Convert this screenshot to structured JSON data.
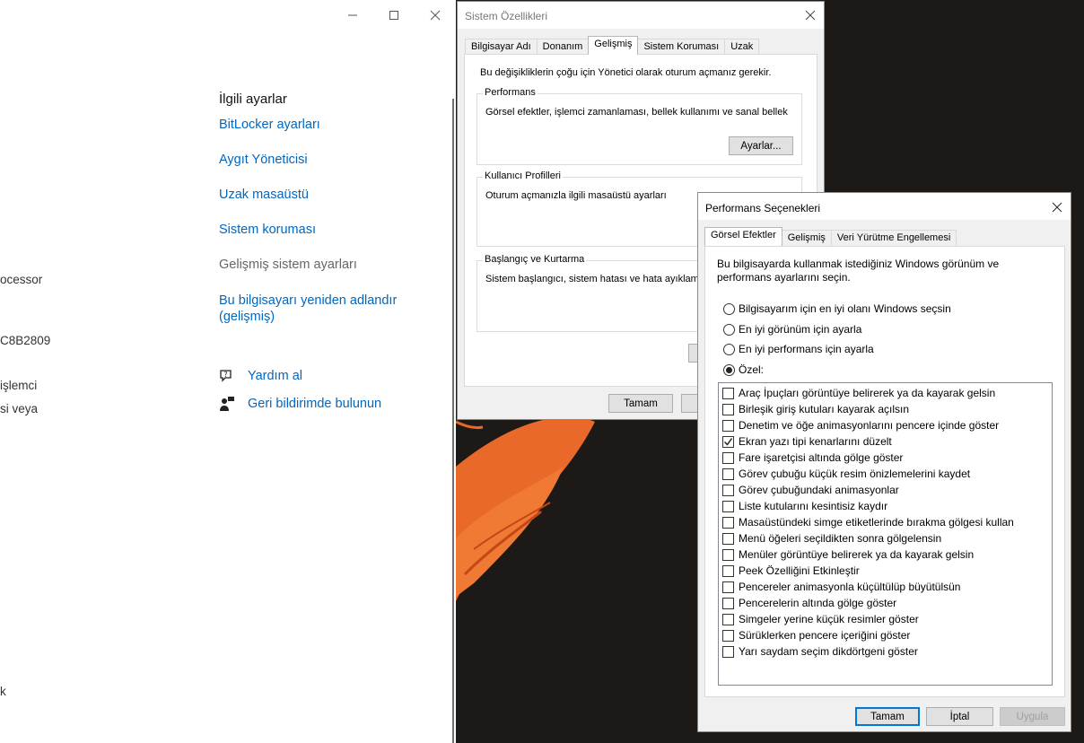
{
  "settings": {
    "clipped_texts": [
      "ocessor",
      "C8B2809",
      "işlemci",
      "si veya",
      "k"
    ],
    "related_title": "İlgili ayarlar",
    "links": [
      "BitLocker ayarları",
      "Aygıt Yöneticisi",
      "Uzak masaüstü",
      "Sistem koruması",
      "Gelişmiş sistem ayarları",
      "Bu bilgisayarı yeniden adlandır (gelişmiş)"
    ],
    "help": "Yardım al",
    "feedback": "Geri bildirimde bulunun"
  },
  "sysprops": {
    "title": "Sistem Özellikleri",
    "tabs": [
      "Bilgisayar Adı",
      "Donanım",
      "Gelişmiş",
      "Sistem Koruması",
      "Uzak"
    ],
    "admin_note": "Bu değişikliklerin çoğu için Yönetici olarak oturum açmanız gerekir.",
    "perf_label": "Performans",
    "perf_text": "Görsel efektler, işlemci zamanlaması, bellek kullanımı ve sanal bellek",
    "settings_button": "Ayarlar...",
    "profiles_label": "Kullanıcı Profilleri",
    "profiles_text": "Oturum açmanızla ilgili masaüstü ayarları",
    "startup_label": "Başlangıç ve Kurtarma",
    "startup_text": "Sistem başlangıcı, sistem hatası ve hata ayıklama b",
    "ok_button": "Tamam"
  },
  "perf": {
    "title": "Performans Seçenekleri",
    "tabs": [
      "Görsel Efektler",
      "Gelişmiş",
      "Veri Yürütme Engellemesi"
    ],
    "description": "Bu bilgisayarda kullanmak istediğiniz Windows görünüm ve performans ayarlarını seçin.",
    "radios": [
      {
        "label": "Bilgisayarım için en iyi olanı Windows seçsin",
        "selected": false
      },
      {
        "label": "En iyi görünüm için ayarla",
        "selected": false
      },
      {
        "label": "En iyi performans için ayarla",
        "selected": false
      },
      {
        "label": "Özel:",
        "selected": true
      }
    ],
    "effects": [
      {
        "label": "Araç İpuçları görüntüye belirerek ya da kayarak gelsin",
        "checked": false
      },
      {
        "label": "Birleşik giriş kutuları kayarak açılsın",
        "checked": false
      },
      {
        "label": "Denetim ve öğe animasyonlarını pencere içinde göster",
        "checked": false
      },
      {
        "label": "Ekran yazı tipi kenarlarını düzelt",
        "checked": true
      },
      {
        "label": "Fare işaretçisi altında gölge göster",
        "checked": false
      },
      {
        "label": "Görev çubuğu küçük resim önizlemelerini kaydet",
        "checked": false
      },
      {
        "label": "Görev çubuğundaki animasyonlar",
        "checked": false
      },
      {
        "label": "Liste kutularını kesintisiz kaydır",
        "checked": false
      },
      {
        "label": "Masaüstündeki simge etiketlerinde bırakma gölgesi kullan",
        "checked": false
      },
      {
        "label": "Menü öğeleri seçildikten sonra gölgelensin",
        "checked": false
      },
      {
        "label": "Menüler görüntüye belirerek ya da kayarak gelsin",
        "checked": false
      },
      {
        "label": "Peek Özelliğini Etkinleştir",
        "checked": false
      },
      {
        "label": "Pencereler animasyonla küçültülüp büyütülsün",
        "checked": false
      },
      {
        "label": "Pencerelerin altında gölge göster",
        "checked": false
      },
      {
        "label": "Simgeler yerine küçük resimler göster",
        "checked": false
      },
      {
        "label": "Sürüklerken pencere içeriğini göster",
        "checked": false
      },
      {
        "label": "Yarı saydam seçim dikdörtgeni göster",
        "checked": false
      }
    ],
    "ok": "Tamam",
    "cancel": "İptal",
    "apply": "Uygula"
  },
  "colors": {
    "link": "#0067c0",
    "accent": "#0078d7",
    "wallpaper_orange": "#e8692a"
  }
}
